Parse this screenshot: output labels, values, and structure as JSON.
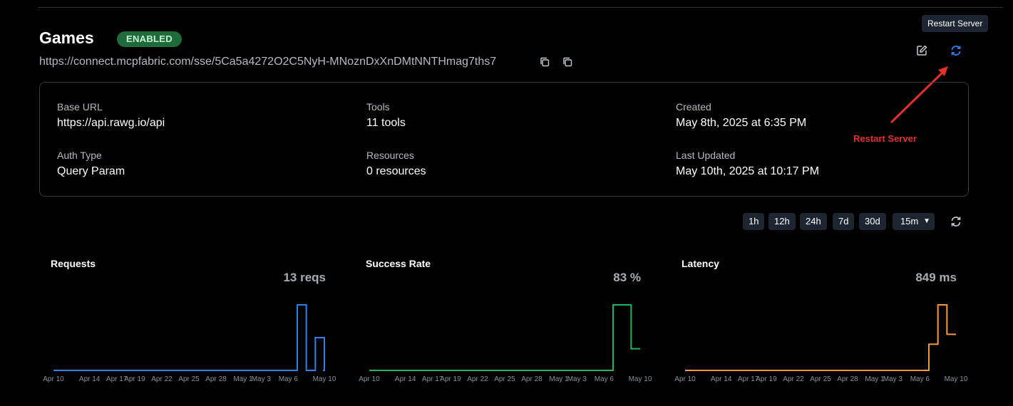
{
  "server": {
    "name": "Games",
    "status": "ENABLED",
    "connect_url": "https://connect.mcpfabric.com/sse/5Ca5a4272O2C5NyH-MNoznDxXnDMtNNTHmag7ths7"
  },
  "toolbar": {
    "tooltip": "Restart Server",
    "edit_icon": "edit-icon",
    "restart_icon": "refresh-icon"
  },
  "annotation": {
    "label": "Restart Server",
    "color": "#e5302c"
  },
  "details": {
    "base_url_label": "Base URL",
    "base_url": "https://api.rawg.io/api",
    "tools_label": "Tools",
    "tools": "11 tools",
    "created_label": "Created",
    "created": "May 8th, 2025 at 6:35 PM",
    "auth_label": "Auth Type",
    "auth": "Query Param",
    "resources_label": "Resources",
    "resources": "0 resources",
    "updated_label": "Last Updated",
    "updated": "May 10th, 2025 at 10:17 PM"
  },
  "time_ranges": [
    "1h",
    "12h",
    "24h",
    "7d",
    "30d"
  ],
  "interval": {
    "selected": "15m"
  },
  "x_tick_labels": [
    "Apr 10",
    "Apr 14",
    "Apr 17",
    "Apr 19",
    "Apr 22",
    "Apr 25",
    "Apr 28",
    "May 1",
    "May 3",
    "May 6",
    "May 10"
  ],
  "chart_data": [
    {
      "type": "line",
      "title": "Requests",
      "summary": "13 reqs",
      "color": "#2f80ed",
      "x": [
        "Apr 10",
        "May 6",
        "May 7",
        "May 8",
        "May 8",
        "May 9",
        "May 10"
      ],
      "values": [
        0,
        0,
        8,
        1,
        0,
        4,
        0
      ]
    },
    {
      "type": "line",
      "title": "Success Rate",
      "summary": "83 %",
      "color": "#22b35e",
      "x": [
        "Apr 10",
        "May 7",
        "May 8",
        "May 9",
        "May 10"
      ],
      "values": [
        0,
        100,
        100,
        33,
        33
      ]
    },
    {
      "type": "line",
      "title": "Latency",
      "summary": "849 ms",
      "color": "#f59a3a",
      "x": [
        "Apr 10",
        "May 7",
        "May 8",
        "May 9",
        "May 10"
      ],
      "values": [
        0,
        400,
        1000,
        550,
        550
      ]
    }
  ]
}
